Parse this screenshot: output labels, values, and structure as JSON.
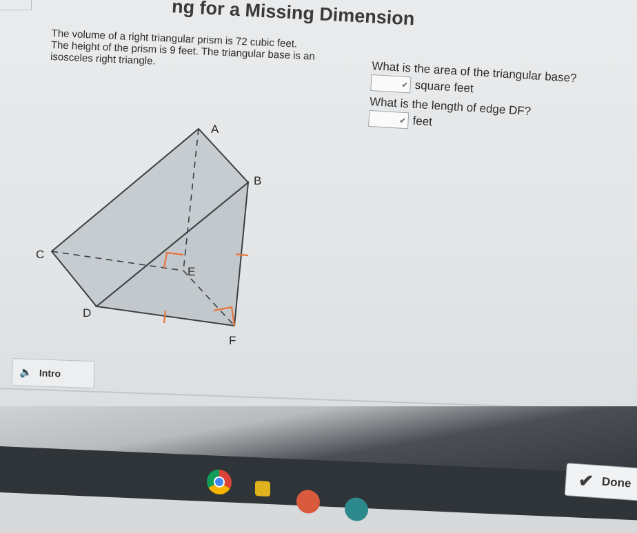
{
  "header": {
    "title": "ng for a Missing Dimension"
  },
  "problem": {
    "line1": "The volume of a right triangular prism is 72 cubic feet.",
    "line2": "The height of the prism is 9 feet. The triangular base is an",
    "line3": "isosceles right triangle."
  },
  "questions": [
    {
      "text": "What is the area of the triangular base?",
      "unit": "square feet",
      "value": ""
    },
    {
      "text": "What is the length of edge DF?",
      "unit": "feet",
      "value": ""
    }
  ],
  "diagram": {
    "vertices": {
      "a": "A",
      "b": "B",
      "c": "C",
      "d": "D",
      "e": "E",
      "f": "F"
    }
  },
  "intro": {
    "label": "Intro"
  },
  "done": {
    "label": "Done"
  },
  "colors": {
    "prism_fill": "#c6cccf",
    "edge": "#3a3f44",
    "accent": "#e8743b"
  }
}
